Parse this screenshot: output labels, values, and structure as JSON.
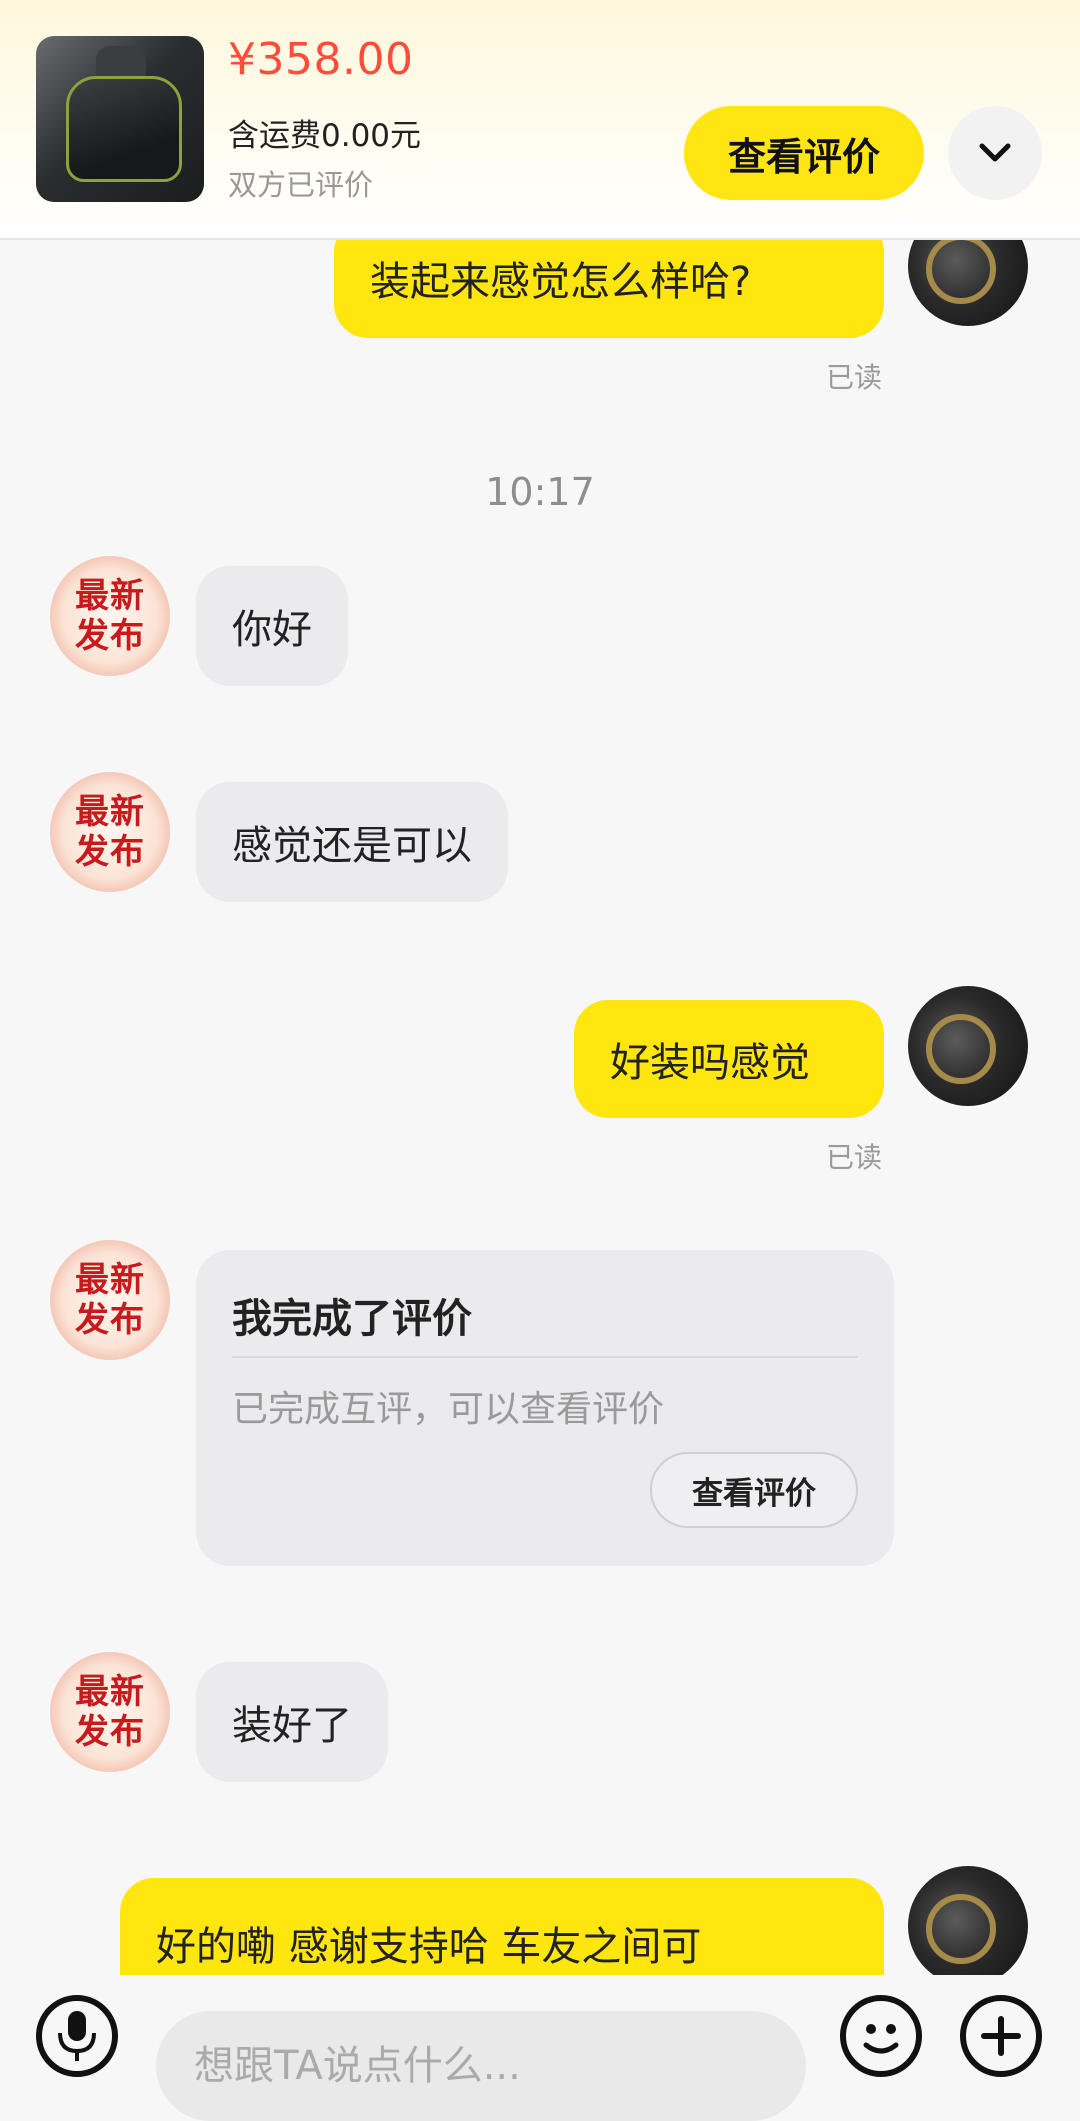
{
  "product": {
    "price": "¥358.00",
    "shipping": "含运费0.00元",
    "status": "双方已评价",
    "view_review_label": "查看评价"
  },
  "messages": {
    "m1": {
      "text": "装起来感觉怎么样哈?",
      "read": "已读"
    },
    "time": "10:17",
    "m2": {
      "text": "你好"
    },
    "m3": {
      "text": "感觉还是可以"
    },
    "m4": {
      "text": "好装吗感觉",
      "read": "已读"
    },
    "card": {
      "title": "我完成了评价",
      "desc": "已完成互评，可以查看评价",
      "button": "查看评价"
    },
    "m5": {
      "text": "装好了"
    },
    "m6": {
      "text": "好的嘞 感谢支持哈 车友之间可"
    }
  },
  "seller_avatar": {
    "line1": "最新",
    "line2": "发布"
  },
  "input": {
    "placeholder": "想跟TA说点什么..."
  },
  "icons": {
    "collapse": "chevron-down-icon",
    "mic": "microphone-icon",
    "emoji": "emoji-icon",
    "plus": "plus-icon"
  },
  "colors": {
    "accent": "#ffe512",
    "price": "#ff4d3a"
  }
}
